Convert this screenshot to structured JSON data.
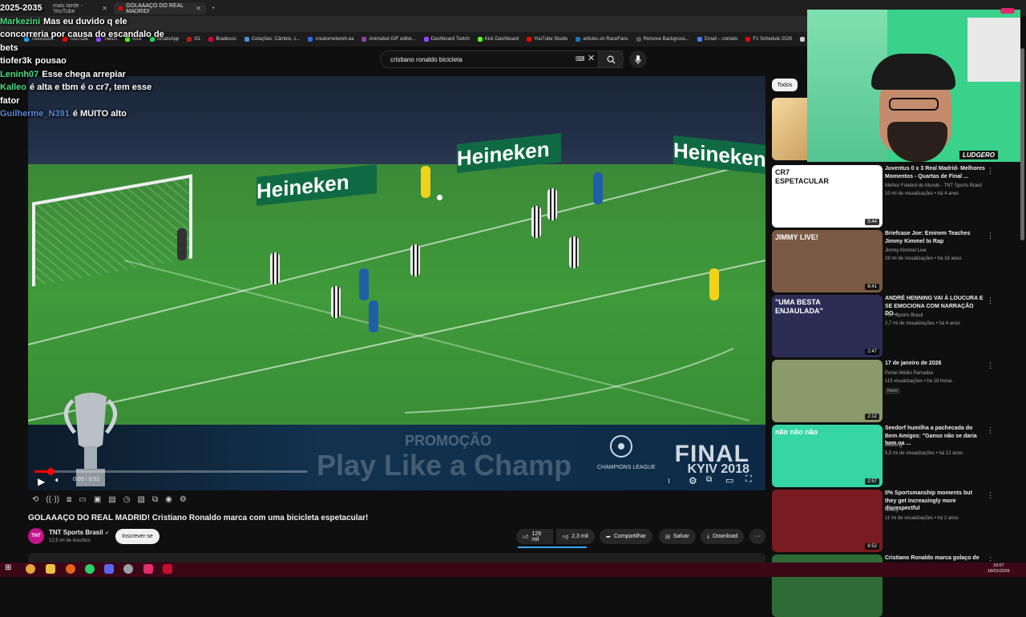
{
  "browser": {
    "tabs": [
      {
        "label": "mais tarde - YouTube"
      },
      {
        "label": "GOLAAAÇO DO REAL MADRID!",
        "active": true
      }
    ],
    "new_tab": "+",
    "bookmarks": [
      "Tweetdeck",
      "YouTube",
      "Twitch",
      "Kick",
      "WhatsApp",
      "G1",
      "Bradesco",
      "Cotações: Câmbio, c...",
      "creatornetwork.ea",
      "Animated GIF editor...",
      "Dashboard Twitch",
      "Kick Dashboard",
      "YouTube Studio",
      "articles on RaceFans",
      "Remove Backgrous...",
      "Email – contato",
      "F1 Schedule 2026",
      "NFS"
    ]
  },
  "stream_overlay": {
    "year_label": "2025-2035",
    "chat": [
      {
        "user": "Markezini",
        "color": "#4ade80",
        "text": "Mas eu duvido q ele concorreria por causa do escandalo de bets"
      },
      {
        "user": "tiofer3k",
        "color": "#ffffff",
        "text": "pousao"
      },
      {
        "user": "Leninh07",
        "color": "#4ade80",
        "text": "Esse chega arrepiar"
      },
      {
        "user": "Kalleo",
        "color": "#4ade80",
        "text": "é alta e tbm é o cr7, tem esse fator"
      },
      {
        "user": "Guilherme_N391",
        "color": "#5a8ad6",
        "text": "é MUITO alto"
      }
    ],
    "webcam_logo": "LUDGERO"
  },
  "header": {
    "search_value": "cristiano ronaldo bicicleta"
  },
  "video": {
    "time": "0:03 / 0:52",
    "progress": 0.06,
    "board_text": "Heineken",
    "banner_promo": "PROMOÇÃO",
    "banner_text": "Play Like a Champ",
    "banner_final": "FINAL",
    "banner_city": "KYIV 2018",
    "banner_ucl": "CHAMPIONS LEAGUE"
  },
  "below": {
    "title": "GOLAAAÇO DO REAL MADRID! Cristiano Ronaldo marca com uma bicicleta espetacular!",
    "channel": "TNT Sports Brasil",
    "channel_avatar": "TNT",
    "subscribers": "12,5 mi de inscritos",
    "subscribe_label": "Inscrever-se",
    "likes": "129 mil",
    "dislikes": "2,3 mil",
    "share_label": "Compartilhar",
    "save_label": "Salvar",
    "download_label": "Download",
    "more_label": "···"
  },
  "sidebar": {
    "chip": "Todos",
    "recommendations": [
      {
        "title": "Juventus 0 x 3 Real Madrid- Melhores Momentos - Quartas de Final ...",
        "channel": "Melhor Futebol do Mundo - TNT Sports Brasil",
        "meta": "10 mi de visualizações • há 4 anos",
        "duration": "5:44",
        "thumb_color": "#ffffff",
        "thumb_text": "CR7 ESPETACULAR"
      },
      {
        "title": "Briefcase Joe: Eminem Teaches Jimmy Kimmel to Rap",
        "channel": "Jimmy Kimmel Live",
        "meta": "29 mi de visualizações • há 16 anos",
        "duration": "6:41",
        "thumb_color": "#7a5a44",
        "thumb_text": "JIMMY LIVE!"
      },
      {
        "title": "ANDRÉ HENNING VAI À LOUCURA E SE EMOCIONA COM NARRAÇÃO DO...",
        "channel": "TNT Sports Brasil",
        "meta": "2,7 mi de visualizações • há 4 anos",
        "duration": "2:47",
        "thumb_color": "#2c2c55",
        "thumb_text": "\"UMA BESTA ENJAULADA\""
      },
      {
        "title": "17 de janeiro de 2026",
        "channel": "Portal Médio Parnaíba",
        "meta": "115 visualizações • há 18 horas",
        "duration": "2:12",
        "thumb_color": "#8a9a6a",
        "thumb_text": "",
        "badge": "Novo"
      },
      {
        "title": "Seedorf humilha a pachecada do Bem Amigos: \"Ganso não se daria bem na ...",
        "channel": "Bilbiung",
        "meta": "5,5 mi de visualizações • há 12 anos",
        "duration": "2:57",
        "thumb_color": "#35d6a4",
        "thumb_text": "não não não"
      },
      {
        "title": "0% Sportsmanship moments but they get increasingly more disrespectful",
        "channel": "Ninety",
        "meta": "11 mi de visualizações • há 2 anos",
        "duration": "6:52",
        "thumb_color": "#7a1a22",
        "thumb_text": ""
      },
      {
        "title": "Cristiano Ronaldo marca golaço de",
        "channel": "",
        "meta": "",
        "duration": "",
        "thumb_color": "#2e6b36",
        "thumb_text": ""
      }
    ]
  },
  "taskbar": {
    "time": "19:07",
    "date": "18/01/2026"
  }
}
